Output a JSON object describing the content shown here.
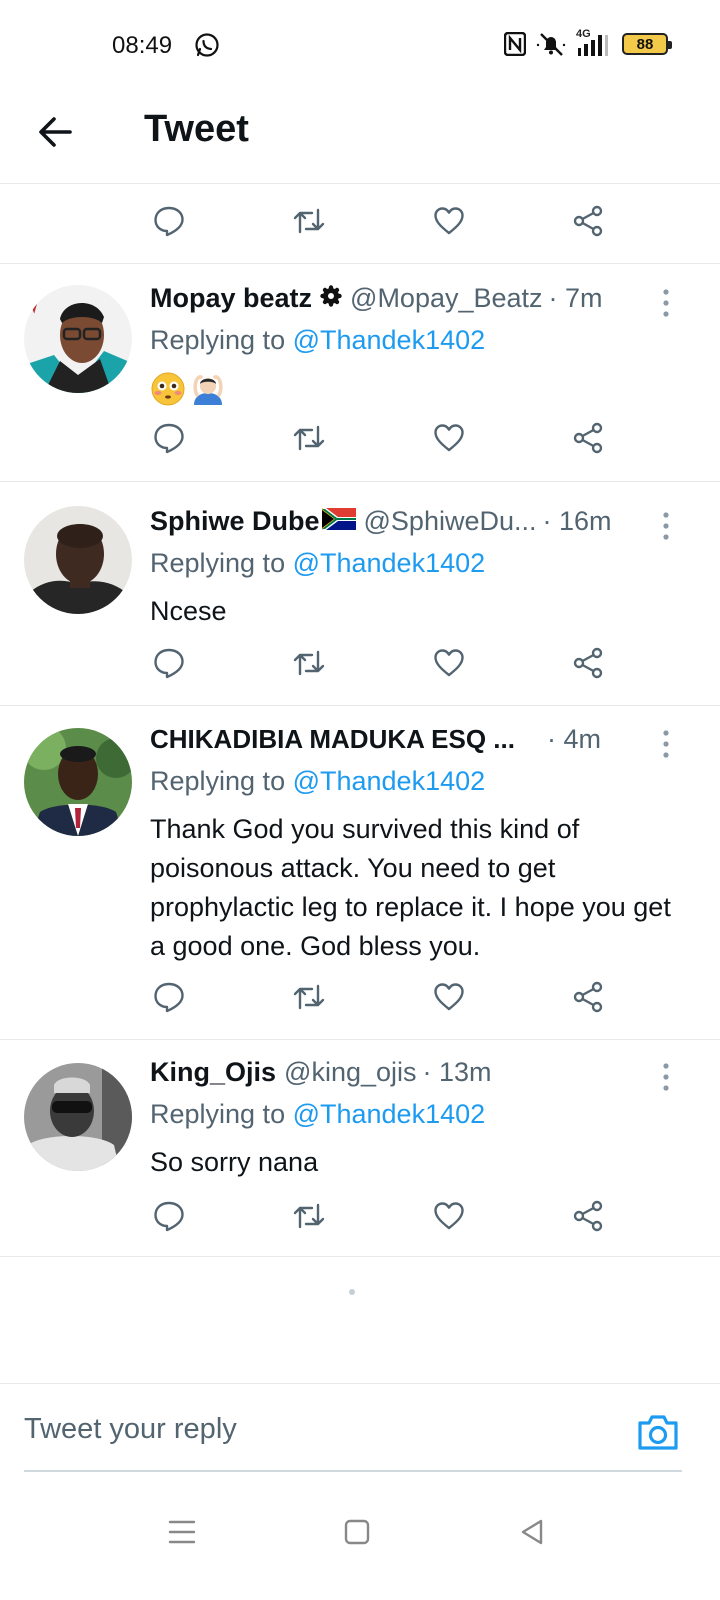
{
  "status_bar": {
    "time": "08:49",
    "network": "4G",
    "battery": "88"
  },
  "header": {
    "title": "Tweet"
  },
  "tweets": [
    {
      "name": "Mopay beatz",
      "handle": "@Mopay_Beatz",
      "time": "· 7m",
      "replying_prefix": "Replying to ",
      "replying_to": "@Thandek1402",
      "text": "",
      "emojis": [
        "😳",
        "🙆🏻‍♂️"
      ]
    },
    {
      "name": "Sphiwe Dube",
      "handle": "@SphiweDu...",
      "time": "· 16m",
      "replying_prefix": "Replying to ",
      "replying_to": "@Thandek1402",
      "text": "Ncese"
    },
    {
      "name": "CHIKADIBIA MADUKA ESQ ...",
      "handle": "",
      "time": "· 4m",
      "replying_prefix": "Replying to ",
      "replying_to": "@Thandek1402",
      "text": "Thank God you survived this kind of poisonous attack. You need to get prophylactic leg to replace it. I hope you get a good one. God bless you."
    },
    {
      "name": "King_Ojis",
      "handle": "@king_ojis",
      "time": "· 13m",
      "replying_prefix": "Replying to ",
      "replying_to": "@Thandek1402",
      "text": "So sorry nana"
    }
  ],
  "composer": {
    "placeholder": "Tweet your reply"
  },
  "colors": {
    "accent": "#1d9bf0",
    "secondary_text": "#536471",
    "primary_text": "#0f1419",
    "divider": "#e6e8ea",
    "battery": "#f3c94a"
  },
  "icons": {
    "back": "arrow-left-icon",
    "reply": "comment-bubble-icon",
    "retweet": "retweet-icon",
    "like": "heart-icon",
    "share": "share-icon",
    "more": "vertical-dots-icon",
    "camera": "camera-icon",
    "nav_menu": "menu-lines-icon",
    "nav_home": "square-icon",
    "nav_back": "triangle-back-icon"
  }
}
